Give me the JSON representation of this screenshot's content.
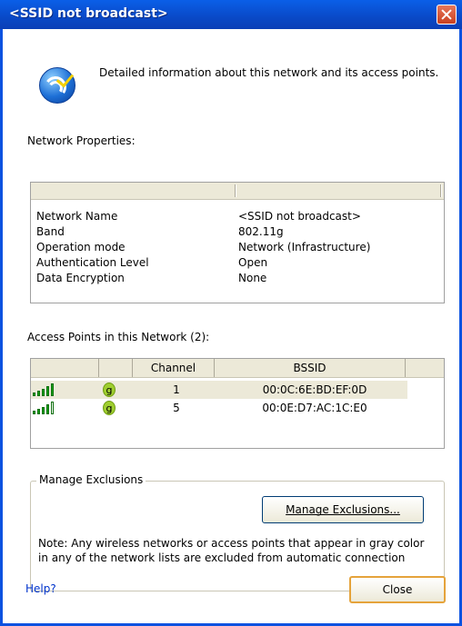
{
  "window": {
    "title": "<SSID not broadcast>"
  },
  "intro_text": "Detailed information about this network and its access points.",
  "network_properties": {
    "label": "Network Properties:",
    "rows": [
      {
        "key": "Network Name",
        "value": "<SSID not broadcast>"
      },
      {
        "key": "Band",
        "value": "802.11g"
      },
      {
        "key": "Operation mode",
        "value": "Network (Infrastructure)"
      },
      {
        "key": "Authentication Level",
        "value": "Open"
      },
      {
        "key": "Data Encryption",
        "value": "None"
      }
    ]
  },
  "access_points": {
    "label": "Access Points in this Network (2):",
    "columns": [
      "",
      "",
      "Channel",
      "BSSID"
    ],
    "rows": [
      {
        "band": "g",
        "channel": "1",
        "bssid": "00:0C:6E:BD:EF:0D",
        "signal_bars": 5,
        "selected": true
      },
      {
        "band": "g",
        "channel": "5",
        "bssid": "00:0E:D7:AC:1C:E0",
        "signal_bars": 4,
        "selected": false
      }
    ]
  },
  "exclusions": {
    "group_title": "Manage Exclusions",
    "button_label": "Manage Exclusions...",
    "note": "Note: Any wireless networks or access points that appear in gray color in any of the network lists are excluded from automatic connection"
  },
  "footer": {
    "help_link": "Help?",
    "close_label": "Close"
  },
  "colors": {
    "titlebar": "#0a52e0",
    "signal": "#1aa51a",
    "band_badge": "#9fce2f",
    "link": "#0033cc"
  }
}
